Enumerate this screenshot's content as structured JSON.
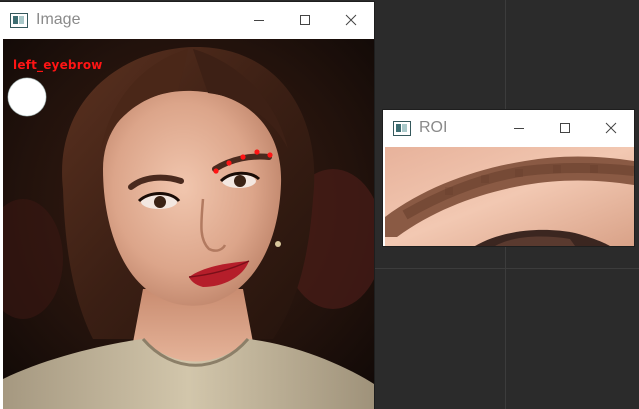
{
  "image_window": {
    "title": "Image",
    "overlay_label": "left_eyebrow",
    "colors": {
      "landmark": "#ff1414",
      "label": "#ff1414",
      "marker": "#ffffff"
    }
  },
  "roi_window": {
    "title": "ROI"
  },
  "icons": {
    "app": "opencv-window-icon",
    "minimize": "minimize-icon",
    "maximize": "maximize-icon",
    "close": "close-icon"
  }
}
